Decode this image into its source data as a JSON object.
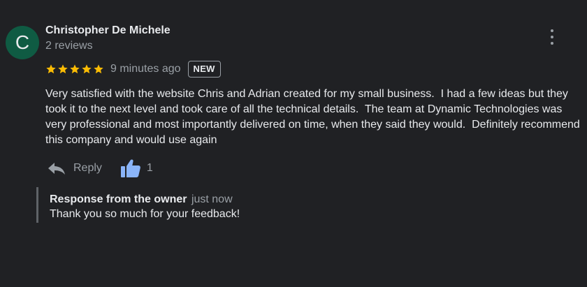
{
  "review": {
    "avatar_letter": "C",
    "avatar_color": "#0f5b43",
    "author_name": "Christopher De Michele",
    "author_reviews": "2 reviews",
    "rating": 5,
    "star_color": "#fbbc04",
    "time_ago": "9 minutes ago",
    "badge": "NEW",
    "text": "Very satisfied with the website Chris and Adrian created for my small business.  I had a few ideas but they took it to the next level and took care of all the technical details.  The team at Dynamic Technologies was very professional and most importantly delivered on time, when they said they would.  Definitely recommend this company and would use again",
    "more_icon": "more-vert-icon"
  },
  "actions": {
    "reply_icon": "reply-icon",
    "reply_label": "Reply",
    "like_icon": "thumbs-up-icon",
    "like_color": "#8ab4f8",
    "like_count": "1"
  },
  "owner_response": {
    "title": "Response from the owner",
    "time": "just now",
    "text": "Thank you so much for your feedback!"
  }
}
